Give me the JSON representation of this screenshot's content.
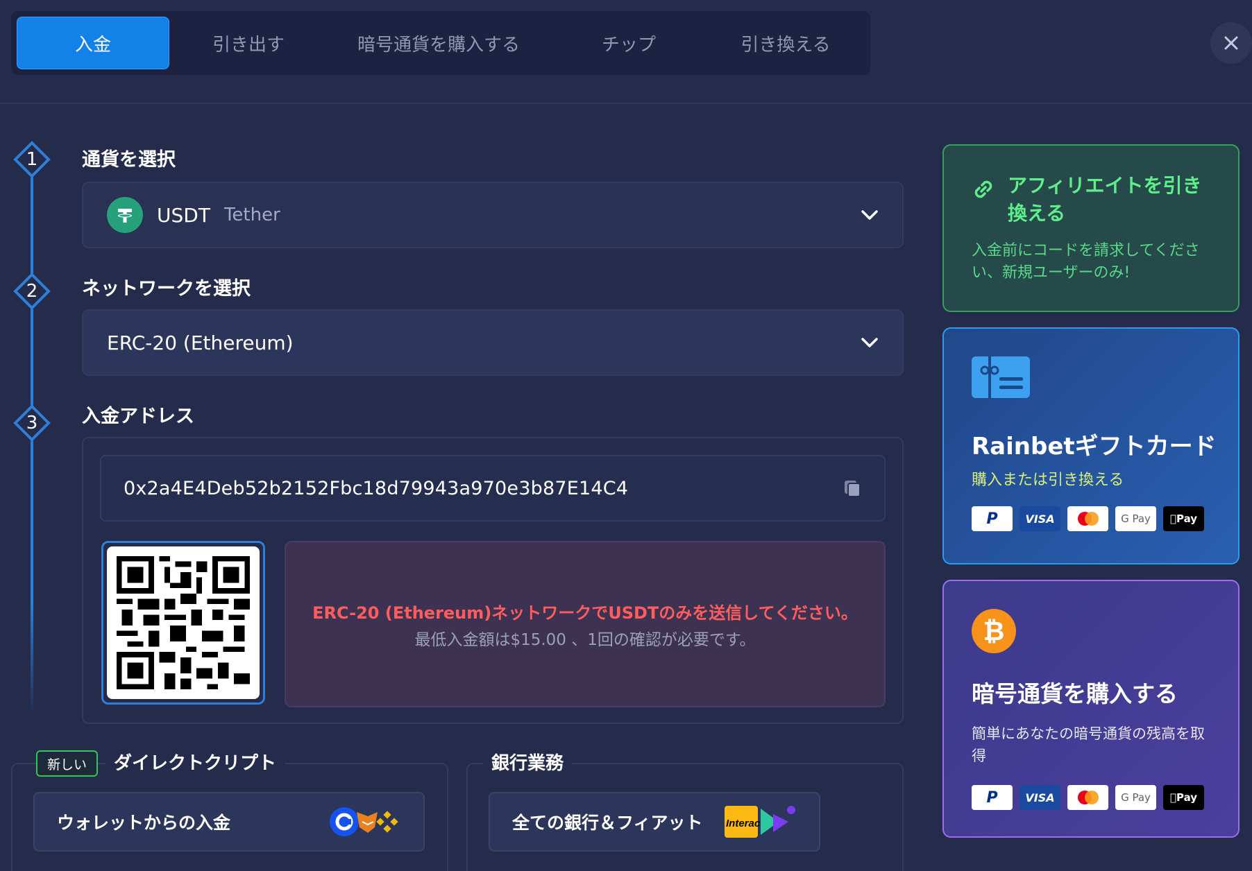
{
  "tabs": [
    {
      "label": "入金",
      "active": true
    },
    {
      "label": "引き出す"
    },
    {
      "label": "暗号通貨を購入する"
    },
    {
      "label": "チップ"
    },
    {
      "label": "引き換える"
    }
  ],
  "steps": {
    "currency": {
      "num": "1",
      "title": "通貨を選択",
      "code": "USDT",
      "name": "Tether"
    },
    "network": {
      "num": "2",
      "title": "ネットワークを選択",
      "value": "ERC-20 (Ethereum)"
    },
    "address": {
      "num": "3",
      "title": "入金アドレス",
      "value": "0x2a4E4Deb52b2152Fbc18d79943a970e3b87E14C4",
      "warning": "ERC-20 (Ethereum)ネットワークでUSDTのみを送信してください。",
      "note": "最低入金額は$15.00 、1回の確認が必要です。"
    }
  },
  "bottom": {
    "direct": {
      "badge": "新しい",
      "title": "ダイレクトクリプト",
      "button": "ウォレットからの入金"
    },
    "bank": {
      "title": "銀行業務",
      "button": "全ての銀行＆フィアット",
      "interac": "Interac"
    }
  },
  "side": {
    "affiliate": {
      "title": "アフィリエイトを引き換える",
      "desc": "入金前にコードを請求してください、新規ユーザーのみ!"
    },
    "gift": {
      "title": "Rainbetギフトカード",
      "sub": "購入または引き換える"
    },
    "buy": {
      "title": "暗号通貨を購入する",
      "desc": "簡単にあなたの暗号通貨の残高を取得"
    },
    "payments": [
      "P",
      "VISA",
      "",
      "G Pay",
      "Pay"
    ]
  },
  "colors": {
    "accent": "#1281e8",
    "bg": "#252c4b",
    "usdt": "#26a17b",
    "warn": "#ff5d5d"
  }
}
